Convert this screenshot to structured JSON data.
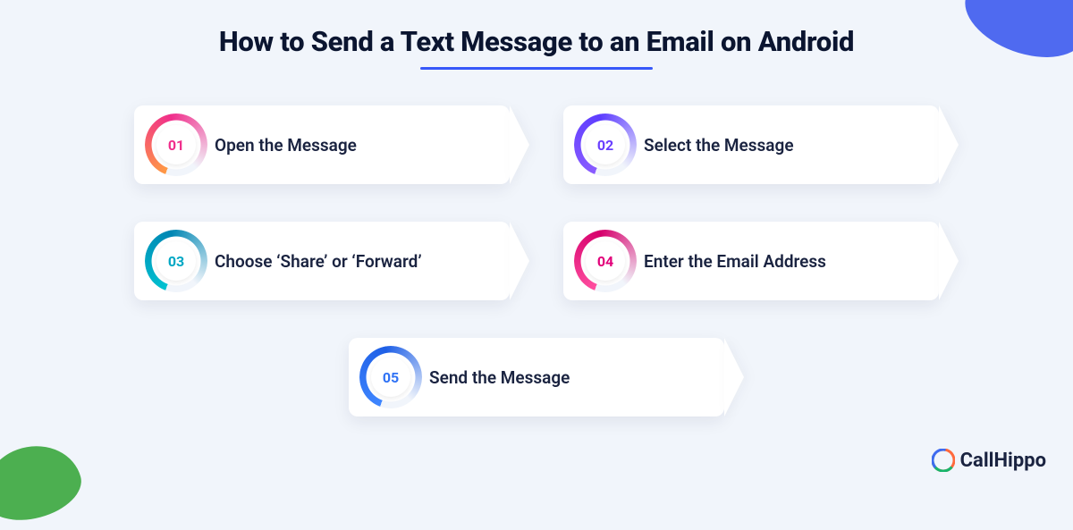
{
  "title": "How to Send a Text Message to an Email on Android",
  "brand": "CallHippo",
  "steps": [
    {
      "num": "01",
      "label": "Open the Message",
      "grad": "linear-gradient(135deg,#ff9a44,#f02e8b)",
      "color": "#f02e8b"
    },
    {
      "num": "02",
      "label": "Select the Message",
      "grad": "linear-gradient(135deg,#8a5cff,#5d3dff)",
      "color": "#6a40ff"
    },
    {
      "num": "03",
      "label": "Choose ‘Share’ or ‘Forward’",
      "grad": "linear-gradient(135deg,#00c2d1,#0086b3)",
      "color": "#00a7c4"
    },
    {
      "num": "04",
      "label": "Enter the Email Address",
      "grad": "linear-gradient(135deg,#ff4fa0,#d6006c)",
      "color": "#e2007a"
    },
    {
      "num": "05",
      "label": "Send the Message",
      "grad": "linear-gradient(135deg,#3f86ff,#1e5fe6)",
      "color": "#2f72f5"
    }
  ]
}
